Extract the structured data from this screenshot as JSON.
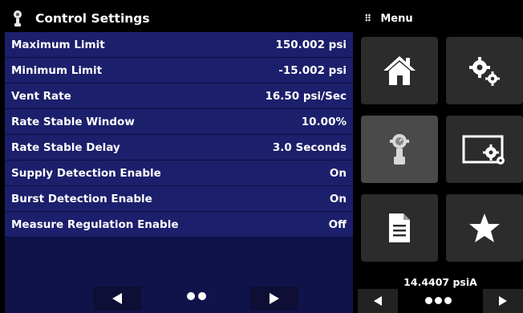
{
  "title": "Control Settings",
  "menu": {
    "label": "Menu"
  },
  "settings": [
    {
      "label": "Maximum Limit",
      "value": "150.002 psi"
    },
    {
      "label": "Minimum Limit",
      "value": "-15.002 psi"
    },
    {
      "label": "Vent Rate",
      "value": "16.50 psi/Sec"
    },
    {
      "label": "Rate Stable Window",
      "value": "10.00%"
    },
    {
      "label": "Rate Stable Delay",
      "value": "3.0 Seconds"
    },
    {
      "label": "Supply Detection Enable",
      "value": "On"
    },
    {
      "label": "Burst Detection Enable",
      "value": "On"
    },
    {
      "label": "Measure Regulation Enable",
      "value": "Off"
    }
  ],
  "tiles": [
    {
      "name": "home",
      "icon": "home-icon"
    },
    {
      "name": "settings",
      "icon": "gears-icon"
    },
    {
      "name": "control",
      "icon": "regulator-icon",
      "selected": true
    },
    {
      "name": "display-settings",
      "icon": "display-gear-icon"
    },
    {
      "name": "document",
      "icon": "document-icon"
    },
    {
      "name": "favorites",
      "icon": "star-icon"
    }
  ],
  "readout": "14.4407 psiA",
  "colors": {
    "row_bg": "#1c1f6b",
    "panel_bg": "#10134a",
    "tile_bg": "#2c2c2c",
    "tile_selected": "#4a4a4a"
  }
}
